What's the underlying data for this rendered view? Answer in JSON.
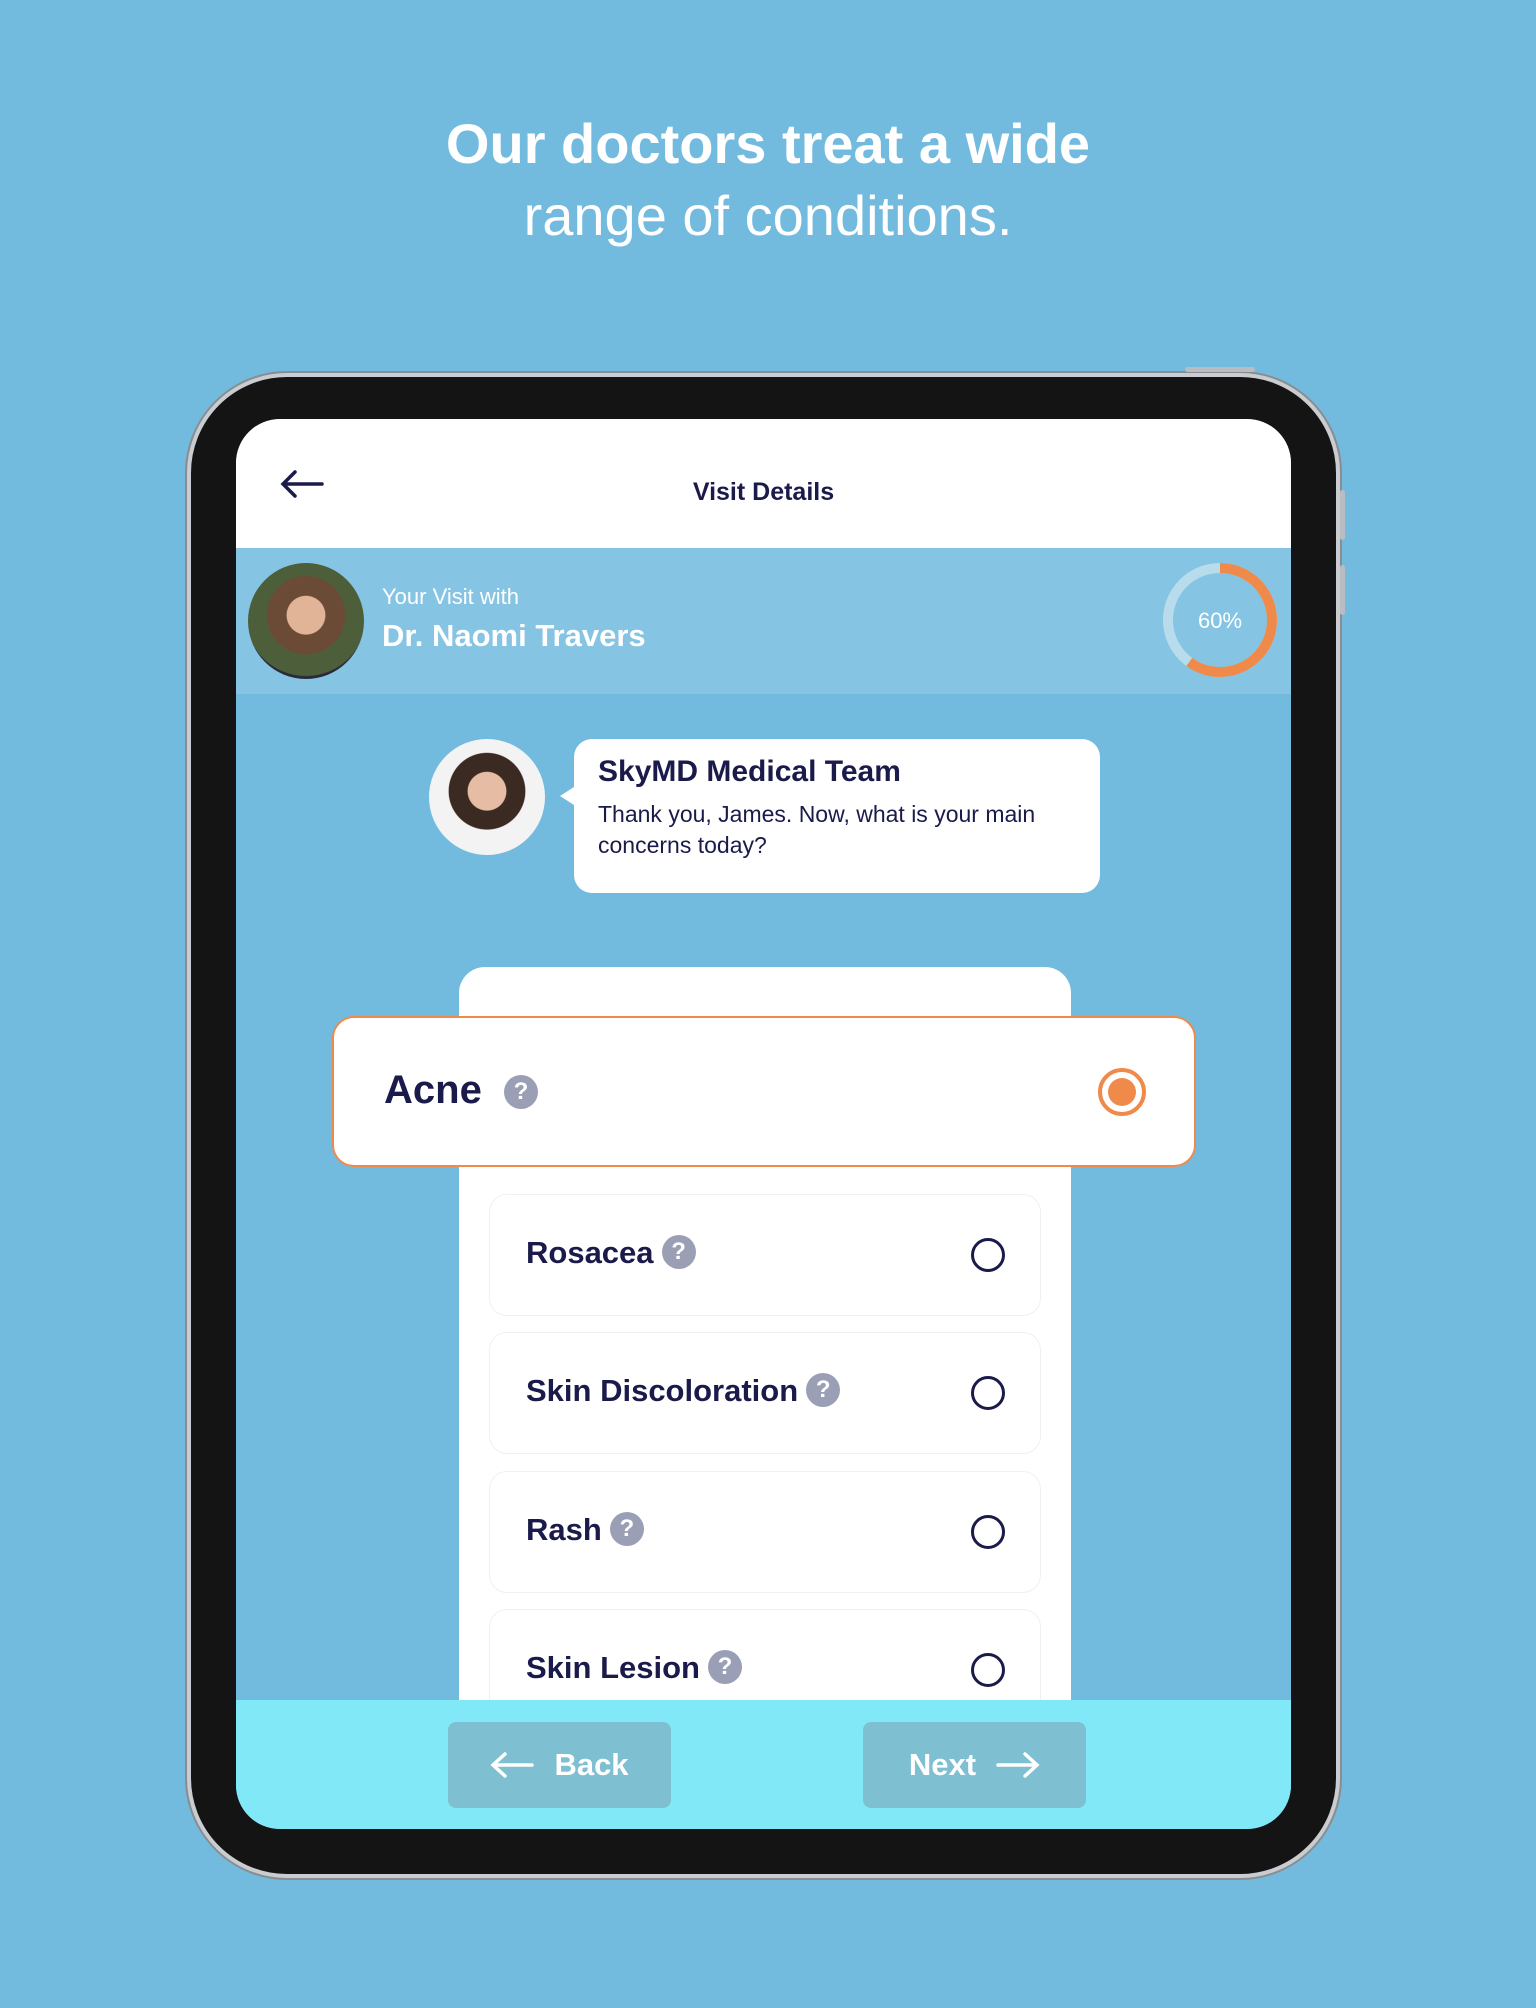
{
  "headline": {
    "line1": "Our doctors treat a wide",
    "line2": "range of conditions."
  },
  "header": {
    "title": "Visit Details",
    "back_icon": "arrow-left-icon"
  },
  "doctor": {
    "label": "Your Visit with",
    "name": "Dr. Naomi Travers",
    "progress_percent": 60,
    "progress_label": "60%"
  },
  "chat": {
    "sender": "SkyMD Medical Team",
    "message": "Thank you, James. Now, what is your main concerns today?"
  },
  "conditions": [
    {
      "label": "Acne",
      "selected": true
    },
    {
      "label": "Rosacea",
      "selected": false
    },
    {
      "label": "Skin Discoloration",
      "selected": false
    },
    {
      "label": "Rash",
      "selected": false
    },
    {
      "label": "Skin Lesion",
      "selected": false
    }
  ],
  "help_glyph": "?",
  "footer": {
    "back_label": "Back",
    "next_label": "Next"
  },
  "colors": {
    "background": "#72bbdf",
    "accent": "#f08a4b",
    "text": "#1a1a4b",
    "footer": "#80e8f7"
  }
}
